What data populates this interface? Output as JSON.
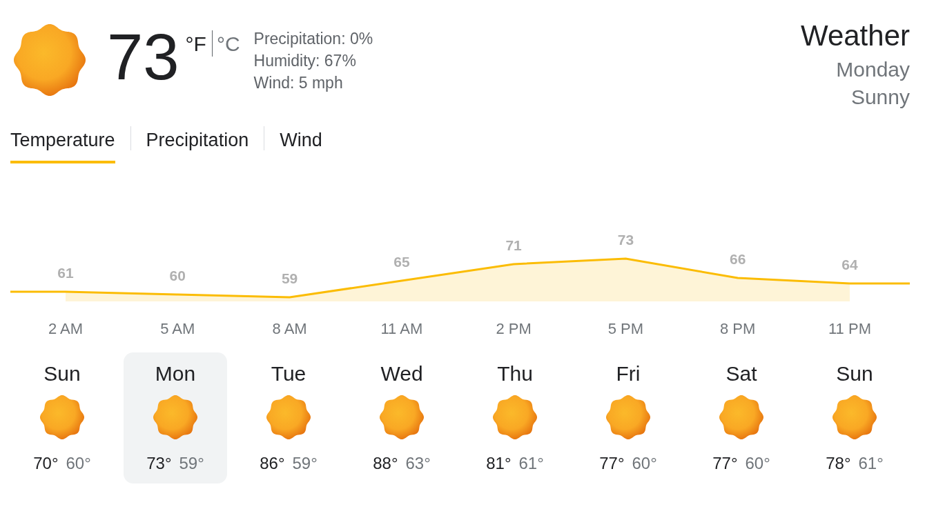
{
  "current": {
    "temperature": "73",
    "units": [
      {
        "label": "°F",
        "selected": true
      },
      {
        "label": "°C",
        "selected": false
      }
    ],
    "details": [
      "Precipitation: 0%",
      "Humidity: 67%",
      "Wind: 5 mph"
    ]
  },
  "header": {
    "title": "Weather",
    "day": "Monday",
    "condition": "Sunny"
  },
  "tabs": [
    {
      "label": "Temperature",
      "selected": true
    },
    {
      "label": "Precipitation",
      "selected": false
    },
    {
      "label": "Wind",
      "selected": false
    }
  ],
  "chart": {
    "chart_data": {
      "type": "area",
      "categories": [
        "2 AM",
        "5 AM",
        "8 AM",
        "11 AM",
        "2 PM",
        "5 PM",
        "8 PM",
        "11 PM"
      ],
      "series": [
        {
          "color": "#fbbc04",
          "values": [
            61,
            60,
            59,
            65,
            71,
            73,
            66,
            64
          ]
        }
      ],
      "data_labels": true
    }
  },
  "forecast": [
    {
      "day": "Sun",
      "high": "70°",
      "low": "60°",
      "selected": false
    },
    {
      "day": "Mon",
      "high": "73°",
      "low": "59°",
      "selected": true
    },
    {
      "day": "Tue",
      "high": "86°",
      "low": "59°",
      "selected": false
    },
    {
      "day": "Wed",
      "high": "88°",
      "low": "63°",
      "selected": false
    },
    {
      "day": "Thu",
      "high": "81°",
      "low": "61°",
      "selected": false
    },
    {
      "day": "Fri",
      "high": "77°",
      "low": "60°",
      "selected": false
    },
    {
      "day": "Sat",
      "high": "77°",
      "low": "60°",
      "selected": false
    },
    {
      "day": "Sun",
      "high": "78°",
      "low": "61°",
      "selected": false
    }
  ]
}
